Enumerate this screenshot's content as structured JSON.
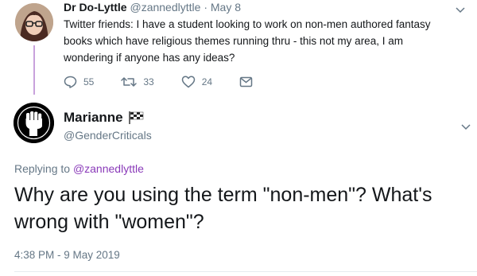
{
  "tweet1": {
    "display_name": "Dr Do-Lyttle",
    "handle": "@zannedlyttle",
    "date": "May 8",
    "separator": "·",
    "text": "Twitter friends: I have a student looking to work on non-men authored fantasy books which have religious themes running thru - this not my area, I am wondering if anyone has any ideas?",
    "counts": {
      "replies": "55",
      "retweets": "33",
      "likes": "24"
    },
    "icons": [
      "reply-icon",
      "retweet-icon",
      "like-icon",
      "message-icon"
    ]
  },
  "tweet2": {
    "display_name": "Marianne",
    "handle": "@GenderCriticals",
    "replying_prefix": "Replying to",
    "replying_handle": "@zannedlyttle",
    "text": "Why are you using the term \"non-men\"? What's wrong with \"women\"?",
    "timestamp": "4:38 PM - 9 May 2019",
    "icons": [
      "checkered-flag-icon",
      "raised-fist-icon",
      "chevron-down-icon"
    ]
  },
  "colors": {
    "text": "#14171a",
    "muted": "#657786",
    "link": "#8a3ab9",
    "thread_line": "#c8a2dc"
  }
}
